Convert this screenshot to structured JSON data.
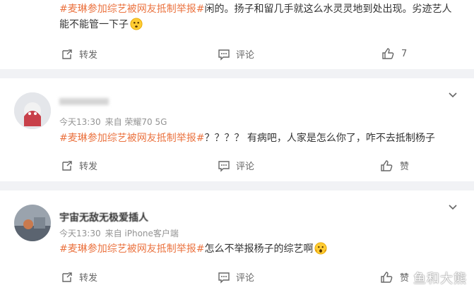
{
  "comments": [
    {
      "hashtag": "#麦琳参加综艺被网友抵制举报#",
      "text": "闲的。扬子和留几手就这么水灵灵地到处出现。劣迹艺人能不能管一下子",
      "actions": {
        "repost": "转发",
        "comment": "评论",
        "like": "7"
      }
    },
    {
      "username": "",
      "time": "今天13:30",
      "source": "来自 荣耀70 5G",
      "hashtag": "#麦琳参加综艺被网友抵制举报#",
      "text": "？？？？ 有病吧，人家是怎么你了，咋不去抵制杨子",
      "actions": {
        "repost": "转发",
        "comment": "评论",
        "like": "赞"
      }
    },
    {
      "username": "宇宙无敌无极爱插人",
      "time": "今天13:30",
      "source": "来自 iPhone客户端",
      "hashtag": "#麦琳参加综艺被网友抵制举报#",
      "text": "怎么不举报杨子的综艺啊",
      "actions": {
        "repost": "转发",
        "comment": "评论",
        "like": "赞"
      }
    }
  ],
  "watermark": "鱼和大熊",
  "colors": {
    "hashtag": "#eb7340",
    "meta": "#939393",
    "divider": "#f1f2f5"
  }
}
